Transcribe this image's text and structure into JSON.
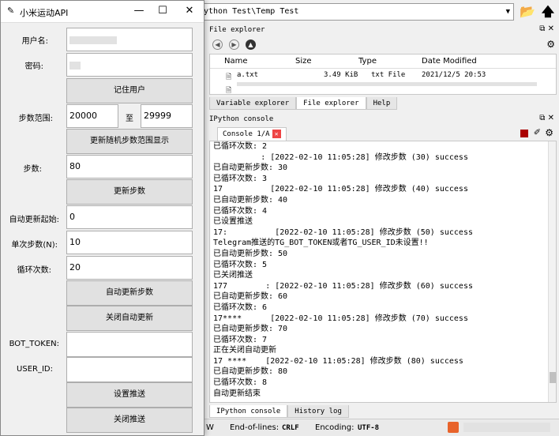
{
  "ide": {
    "path": "ython Test\\Temp Test",
    "file_explorer": {
      "title": "File explorer",
      "columns": [
        "Name",
        "Size",
        "Type",
        "Date Modified"
      ],
      "rows": [
        {
          "name": "a.txt",
          "size": "3.49 KiB",
          "type": "txt File",
          "date": "2021/12/5 20:53"
        }
      ]
    },
    "top_tabs": [
      "Variable explorer",
      "File explorer",
      "Help"
    ],
    "console_title": "IPython console",
    "console_tab": "Console 1/A",
    "console_lines": [
      "已循环次数: 2",
      "          : [2022-02-10 11:05:28] 修改步数 (30) success",
      "已自动更新步数: 30",
      "已循环次数: 3",
      "17          [2022-02-10 11:05:28] 修改步数 (40) success",
      "已自动更新步数: 40",
      "已循环次数: 4",
      "已设置推送",
      "17:          [2022-02-10 11:05:28] 修改步数 (50) success",
      "Telegram推送的TG_BOT_TOKEN或者TG_USER_ID未设置!!",
      "已自动更新步数: 50",
      "已循环次数: 5",
      "已关闭推送",
      "177        : [2022-02-10 11:05:28] 修改步数 (60) success",
      "已自动更新步数: 60",
      "已循环次数: 6",
      "17****      [2022-02-10 11:05:28] 修改步数 (70) success",
      "已自动更新步数: 70",
      "已循环次数: 7",
      "正在关闭自动更新",
      "17 ****    [2022-02-10 11:05:28] 修改步数 (80) success",
      "已自动更新步数: 80",
      "已循环次数: 8",
      "自动更新结束"
    ],
    "bottom_tabs": [
      "IPython console",
      "History log"
    ],
    "status": {
      "eol_label": "End-of-lines:",
      "eol_value": "CRLF",
      "enc_label": "Encoding:",
      "enc_value": "UTF-8"
    }
  },
  "app": {
    "title": "小米运动API",
    "username_label": "用户名:",
    "password_label": "密码:",
    "remember_button": "记住用户",
    "range_label": "步数范围:",
    "range_from": "20000",
    "range_to_label": "至",
    "range_to": "29999",
    "random_button": "更新随机步数范围显示",
    "steps_label": "步数:",
    "steps_value": "80",
    "update_button": "更新步数",
    "auto_start_label": "自动更新起始:",
    "auto_start_value": "0",
    "per_step_label": "单次步数(N):",
    "per_step_value": "10",
    "loops_label": "循环次数:",
    "loops_value": "20",
    "auto_update_button": "自动更新步数",
    "close_auto_button": "关闭自动更新",
    "bot_token_label": "BOT_TOKEN:",
    "user_id_label": "USER_ID:",
    "set_push_button": "设置推送",
    "close_push_button": "关闭推送"
  }
}
